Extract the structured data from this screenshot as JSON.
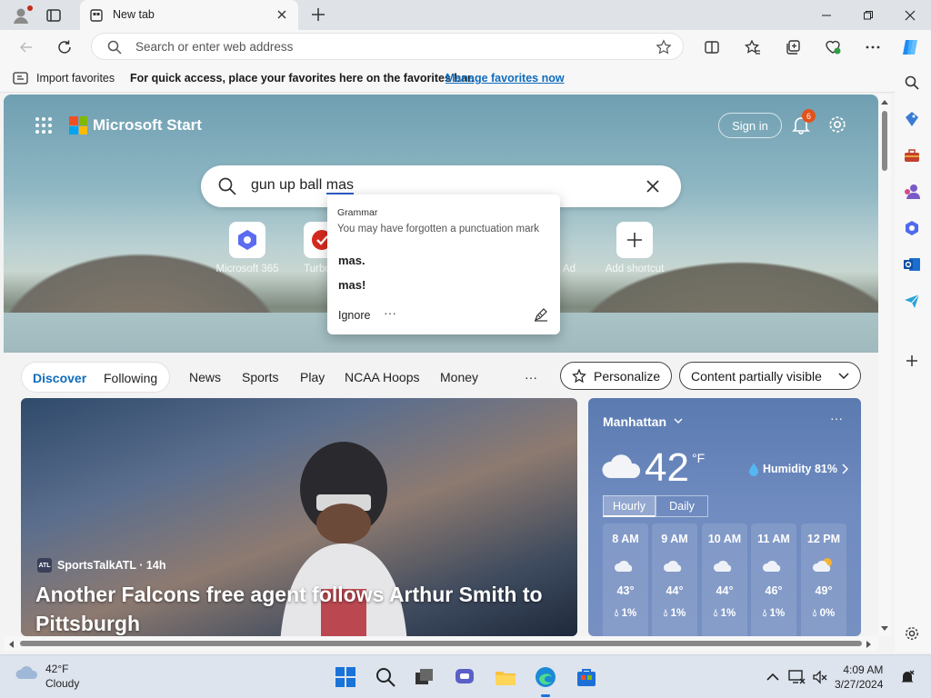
{
  "browser": {
    "tab_title": "New tab",
    "omnibox_placeholder": "Search or enter web address",
    "favorites_import": "Import favorites",
    "favorites_hint": "For quick access, place your favorites here on the favorites bar.",
    "favorites_link": "Manage favorites now"
  },
  "start": {
    "brand": "Microsoft Start",
    "signin": "Sign in",
    "notifications": "6",
    "search_text_before": "gun up ball ",
    "search_text_error": "mas"
  },
  "grammar_popup": {
    "title": "Grammar",
    "description": "You may have forgotten a punctuation mark",
    "suggestions": [
      "mas.",
      "mas!"
    ],
    "ignore": "Ignore",
    "more": "···"
  },
  "shortcuts": [
    {
      "label": "Microsoft 365"
    },
    {
      "label": "Turbo T"
    },
    {
      "label": "Ad"
    },
    {
      "label": "Add shortcut"
    }
  ],
  "feed": {
    "tabs": [
      "Discover",
      "Following",
      "News",
      "Sports",
      "Play",
      "NCAA Hoops",
      "Money"
    ],
    "more": "···",
    "personalize": "Personalize",
    "content_visibility": "Content partially visible"
  },
  "news": {
    "source": "SportsTalkATL · 14h",
    "source_badge": "ATL",
    "headline": "Another Falcons free agent follows Arthur Smith to Pittsburgh"
  },
  "weather": {
    "location": "Manhattan",
    "more": "···",
    "temp": "42",
    "unit": "°F",
    "humidity": "Humidity 81%",
    "tabs": [
      "Hourly",
      "Daily"
    ],
    "hours": [
      {
        "time": "8 AM",
        "temp": "43°",
        "precip": "1%",
        "icon": "cloud"
      },
      {
        "time": "9 AM",
        "temp": "44°",
        "precip": "1%",
        "icon": "cloud"
      },
      {
        "time": "10 AM",
        "temp": "44°",
        "precip": "1%",
        "icon": "cloud"
      },
      {
        "time": "11 AM",
        "temp": "46°",
        "precip": "1%",
        "icon": "cloud"
      },
      {
        "time": "12 PM",
        "temp": "49°",
        "precip": "0%",
        "icon": "partly-sunny"
      }
    ]
  },
  "taskbar": {
    "weather_temp": "42°F",
    "weather_desc": "Cloudy",
    "time": "4:09 AM",
    "date": "3/27/2024"
  },
  "colors": {
    "accent": "#0f6cbd",
    "badge": "#e2521b"
  }
}
